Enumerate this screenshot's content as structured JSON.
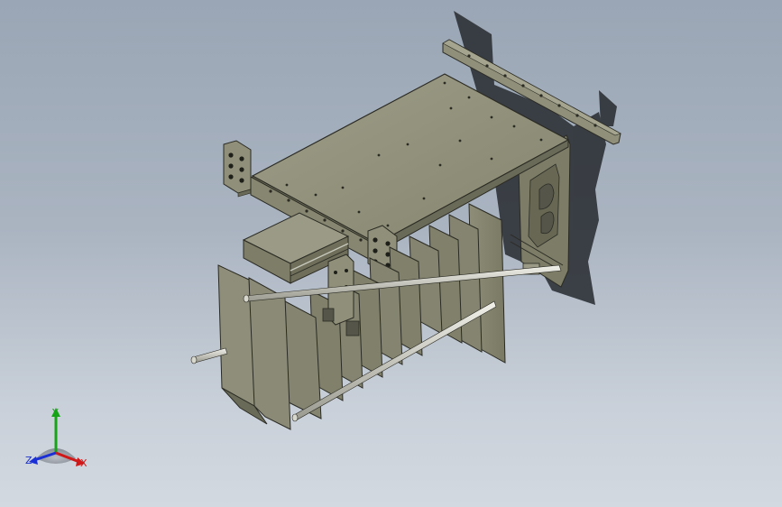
{
  "viewport": {
    "background_top": "#9aa6b5",
    "background_bottom": "#d3d9e0",
    "model": {
      "part_fill": "#8a8a76",
      "part_fill_light": "#9a9a86",
      "part_fill_dark": "#6a6a58",
      "edge_color": "#2b2b24",
      "shadow_color": "#2a2d33"
    }
  },
  "triad": {
    "x_label": "X",
    "y_label": "Y",
    "z_label": "Z",
    "x_color": "#d01818",
    "y_color": "#17a317",
    "z_color": "#1a2fd6"
  }
}
